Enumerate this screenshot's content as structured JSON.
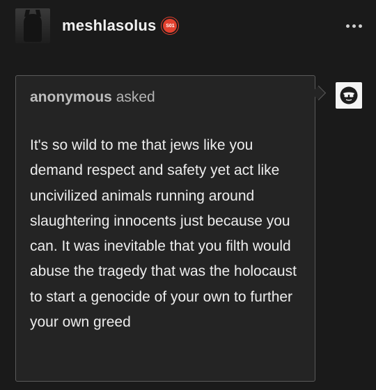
{
  "header": {
    "username": "meshlasolus",
    "badge_text": "S01",
    "more_icon": "more-horizontal-icon"
  },
  "ask": {
    "asker_name": "anonymous",
    "asker_suffix": "asked",
    "question": "It's so wild to me that jews like you demand respect and safety yet act like uncivilized animals running around slaughtering innocents just because you can. It was inevitable that you filth would abuse the tragedy that was the holocaust to start a genocide of your own to further your own greed"
  },
  "colors": {
    "background": "#1a1a1a",
    "box": "#242424",
    "badge": "#e2412f"
  }
}
